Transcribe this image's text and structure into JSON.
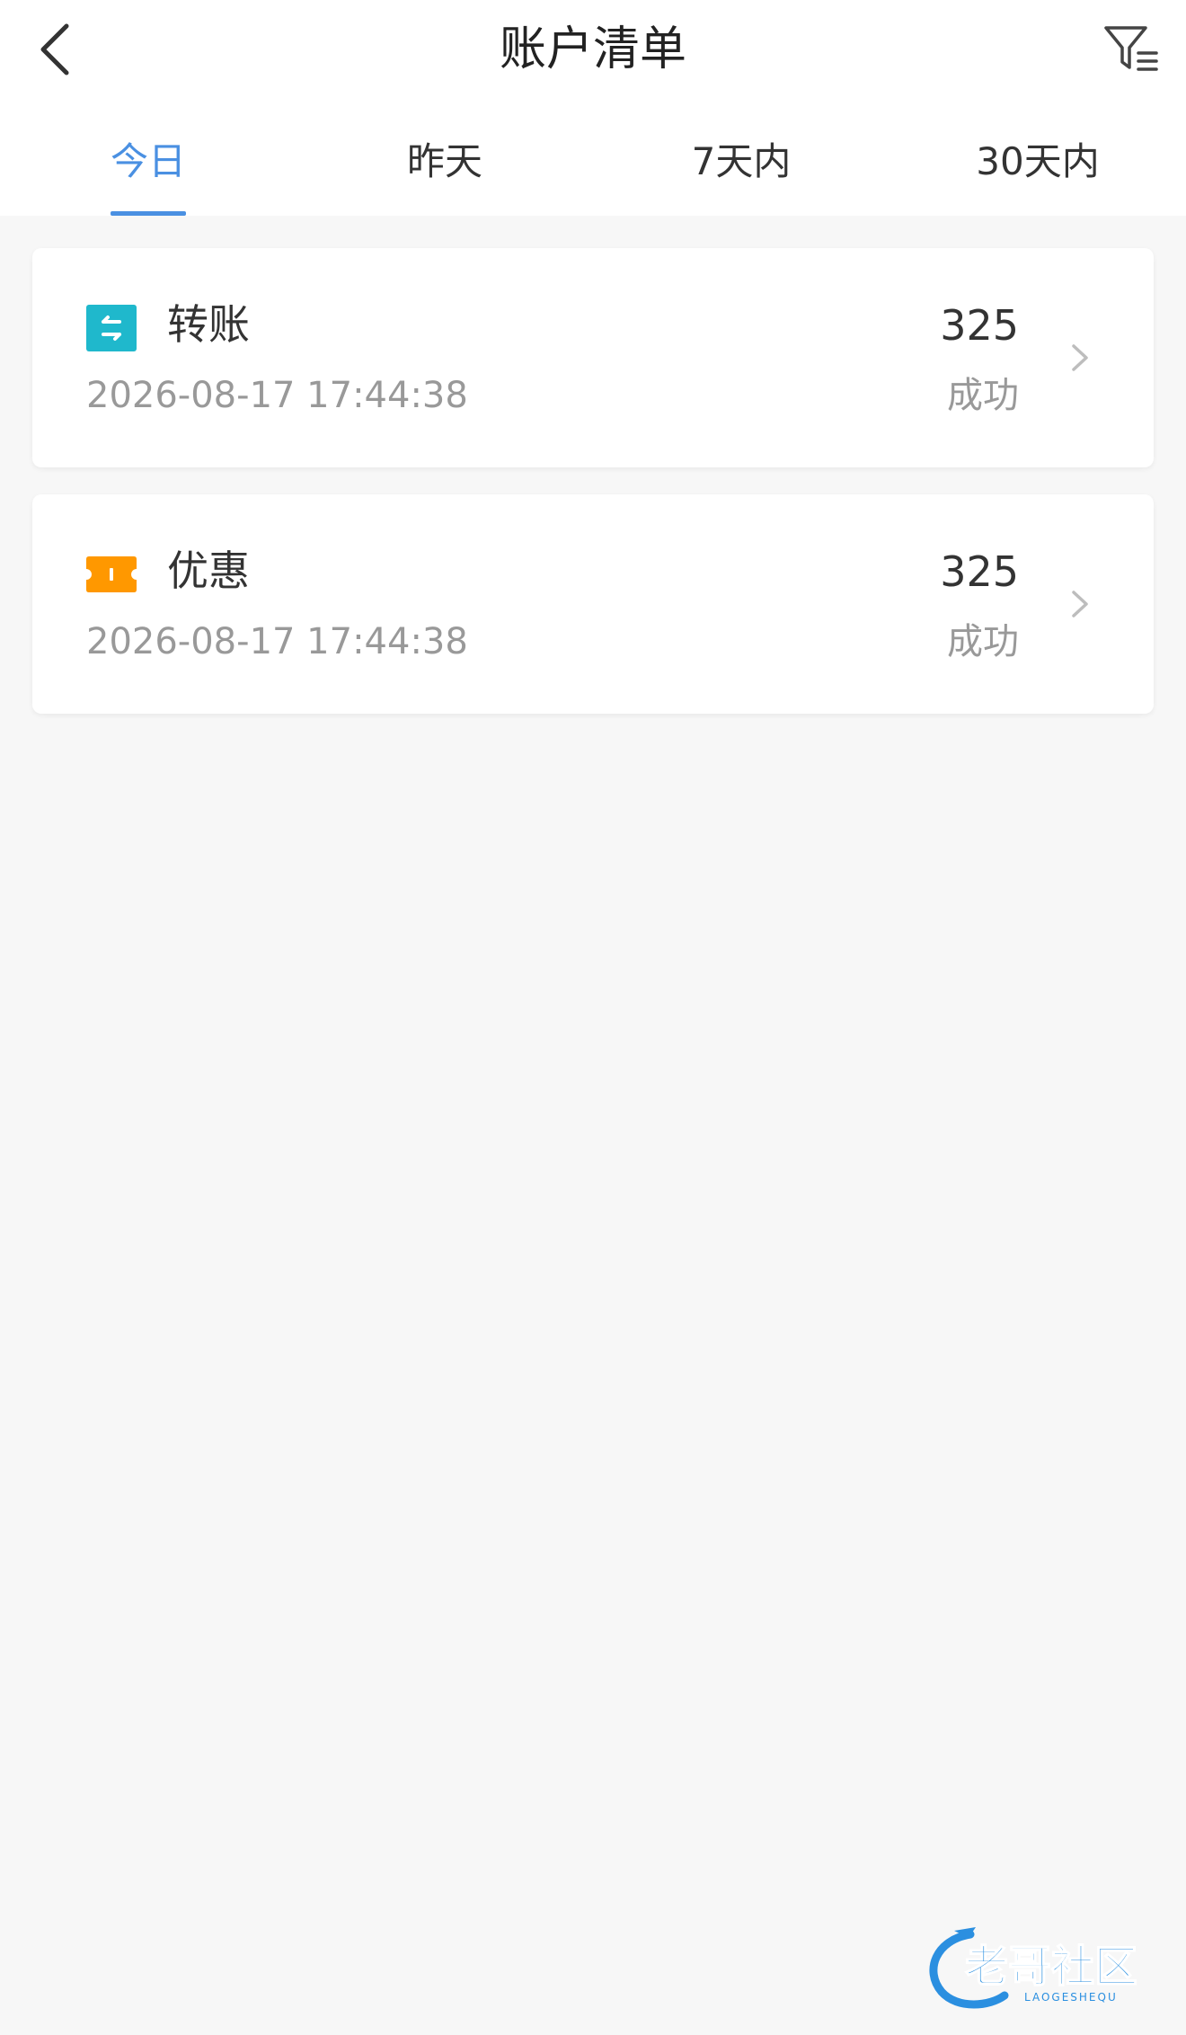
{
  "header": {
    "title": "账户清单",
    "back_icon": "chevron-left-icon",
    "filter_icon": "filter-icon"
  },
  "tabs": [
    {
      "label": "今日",
      "active": true
    },
    {
      "label": "昨天",
      "active": false
    },
    {
      "label": "7天内",
      "active": false
    },
    {
      "label": "30天内",
      "active": false
    }
  ],
  "records": [
    {
      "icon": "transfer-icon",
      "icon_color": "#1fb8cc",
      "title": "转账",
      "time": "2026-08-17 17:44:38",
      "amount": "325",
      "status": "成功"
    },
    {
      "icon": "coupon-icon",
      "icon_color": "#ff9800",
      "title": "优惠",
      "time": "2026-08-17 17:44:38",
      "amount": "325",
      "status": "成功"
    }
  ],
  "watermark": {
    "text": "老哥社区",
    "subtext": "LAOGESHEQU"
  },
  "colors": {
    "accent": "#4a90e2",
    "background": "#f7f7f7"
  }
}
